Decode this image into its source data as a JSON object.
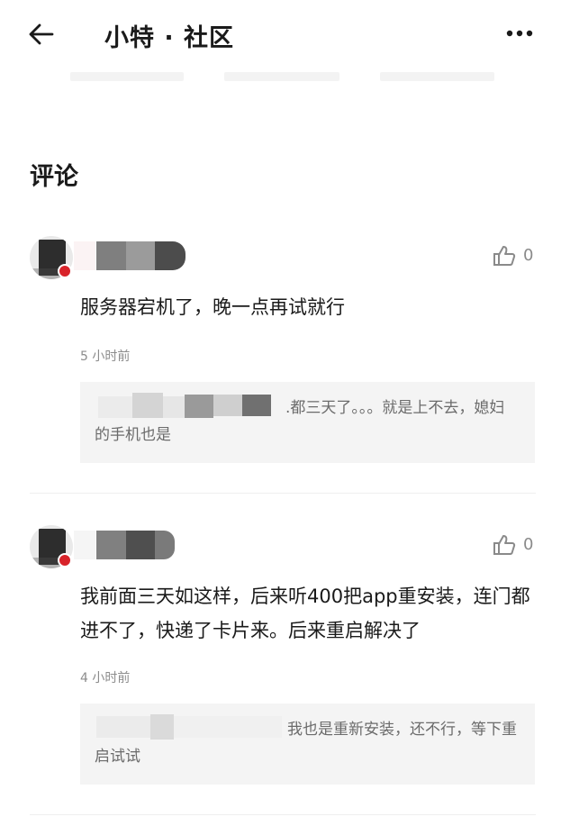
{
  "header": {
    "title": "小特 · 社区",
    "back_icon": "arrow-left-icon",
    "more_icon": "more-horizontal-icon"
  },
  "section": {
    "title": "评论"
  },
  "comments": [
    {
      "text": "服务器宕机了，晚一点再试就行",
      "time": "5 小时前",
      "likes": "0",
      "reply": ".都三天了。。。就是上不去，媳妇的手机也是"
    },
    {
      "text": "我前面三天如这样，后来听400把app重安装，连门都进不了，快递了卡片来。后来重启解决了",
      "time": "4 小时前",
      "likes": "0",
      "reply": "我也是重新安装，还不行，等下重启试试"
    }
  ],
  "colors": {
    "badge": "#d8232a",
    "text": "#1a1a1a",
    "muted": "#8c8c8c",
    "reply_bg": "#f4f4f4"
  }
}
